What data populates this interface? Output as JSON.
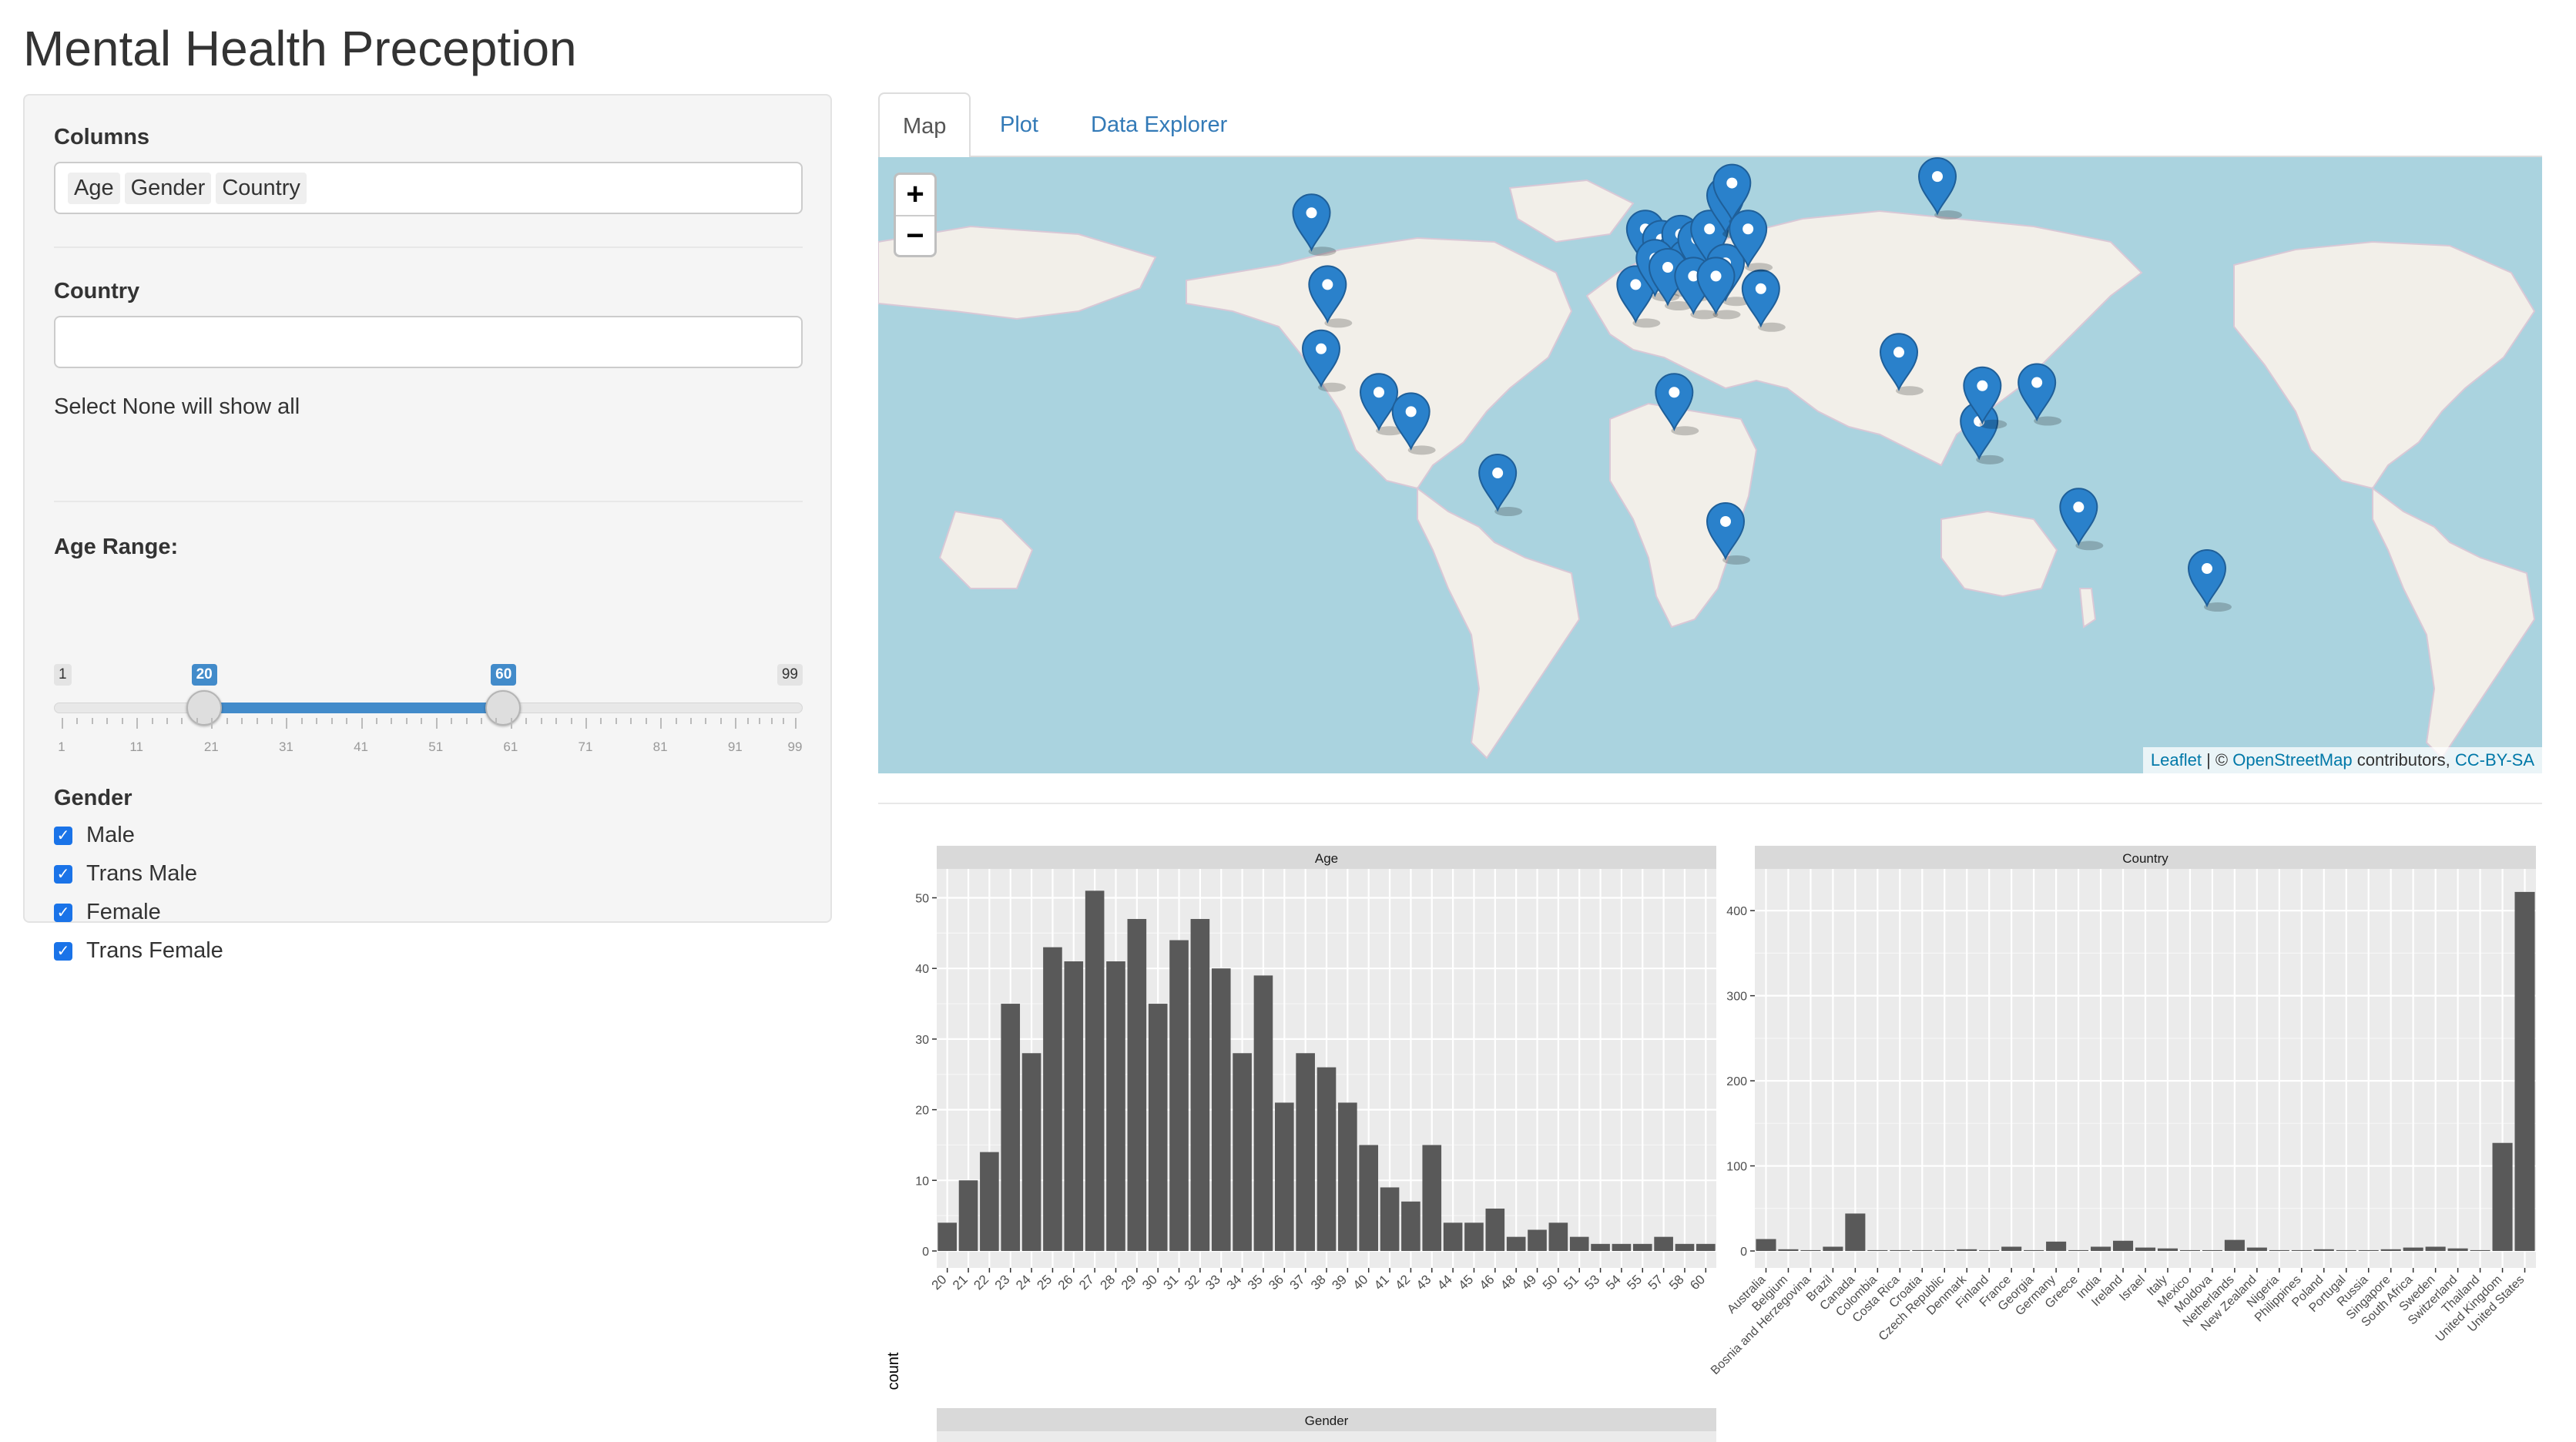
{
  "app_title": "Mental Health Preception",
  "sidebar": {
    "columns_label": "Columns",
    "columns_selected": [
      "Age",
      "Gender",
      "Country"
    ],
    "country_label": "Country",
    "country_value": "",
    "country_help": "Select None will show all",
    "age_label": "Age Range:",
    "age_slider": {
      "min": 1,
      "max": 99,
      "from": 20,
      "to": 60,
      "ticks": [
        "1",
        "11",
        "21",
        "31",
        "41",
        "51",
        "61",
        "71",
        "81",
        "91",
        "99"
      ],
      "min_label": "1",
      "max_label": "99",
      "from_label": "20",
      "to_label": "60"
    },
    "gender_label": "Gender",
    "gender_options": [
      {
        "label": "Male",
        "checked": true
      },
      {
        "label": "Trans Male",
        "checked": true
      },
      {
        "label": "Female",
        "checked": true
      },
      {
        "label": "Trans Female",
        "checked": true
      }
    ]
  },
  "tabs": [
    {
      "label": "Map",
      "active": true
    },
    {
      "label": "Plot",
      "active": false
    },
    {
      "label": "Data Explorer",
      "active": false
    }
  ],
  "map": {
    "zoom_in": "+",
    "zoom_out": "−",
    "attribution": {
      "leaflet": "Leaflet",
      "sep": "| ©",
      "osm": "OpenStreetMap",
      "contrib": "contributors,",
      "license": "CC-BY-SA"
    },
    "marker_icon": "map-marker-icon",
    "marker_color": "#2a81cb",
    "markers": [
      [
        -105,
        55
      ],
      [
        -100,
        40
      ],
      [
        -102,
        23
      ],
      [
        -84,
        10
      ],
      [
        -74,
        4
      ],
      [
        -47,
        -15
      ],
      [
        -1,
        52
      ],
      [
        4,
        50
      ],
      [
        8,
        47
      ],
      [
        10,
        51
      ],
      [
        12,
        46
      ],
      [
        15,
        50
      ],
      [
        19,
        52
      ],
      [
        24,
        58
      ],
      [
        26,
        60
      ],
      [
        24,
        45
      ],
      [
        -4,
        40
      ],
      [
        2,
        46
      ],
      [
        6,
        44
      ],
      [
        14,
        42
      ],
      [
        21,
        42
      ],
      [
        35,
        39
      ],
      [
        31,
        52
      ],
      [
        8,
        10
      ],
      [
        24,
        -29
      ],
      [
        78,
        22
      ],
      [
        103,
        1
      ],
      [
        104,
        12
      ],
      [
        121,
        13
      ],
      [
        90,
        61
      ],
      [
        134,
        -25
      ],
      [
        174,
        -41
      ]
    ]
  },
  "chart_data": [
    {
      "type": "bar",
      "title": "Age",
      "ylabel": "count",
      "categories": [
        "20",
        "21",
        "22",
        "23",
        "24",
        "25",
        "26",
        "27",
        "28",
        "29",
        "30",
        "31",
        "32",
        "33",
        "34",
        "35",
        "36",
        "37",
        "38",
        "39",
        "40",
        "41",
        "42",
        "43",
        "44",
        "45",
        "46",
        "48",
        "49",
        "50",
        "51",
        "53",
        "54",
        "55",
        "57",
        "58",
        "60"
      ],
      "values": [
        4,
        10,
        14,
        35,
        28,
        43,
        41,
        51,
        41,
        47,
        35,
        44,
        47,
        40,
        28,
        39,
        21,
        28,
        26,
        21,
        15,
        9,
        7,
        15,
        4,
        4,
        6,
        2,
        3,
        4,
        2,
        1,
        1,
        1,
        2,
        1,
        1
      ],
      "yticks": [
        0,
        10,
        20,
        30,
        40,
        50
      ],
      "ylim": [
        0,
        53
      ]
    },
    {
      "type": "bar",
      "title": "Country",
      "ylabel": "count",
      "categories": [
        "Australia",
        "Belgium",
        "Bosnia and Herzegovina",
        "Brazil",
        "Canada",
        "Colombia",
        "Costa Rica",
        "Croatia",
        "Czech Republic",
        "Denmark",
        "Finland",
        "France",
        "Georgia",
        "Germany",
        "Greece",
        "India",
        "Ireland",
        "Israel",
        "Italy",
        "Mexico",
        "Moldova",
        "Netherlands",
        "New Zealand",
        "Nigeria",
        "Philippines",
        "Poland",
        "Portugal",
        "Russia",
        "Singapore",
        "South Africa",
        "Sweden",
        "Switzerland",
        "Thailand",
        "United Kingdom",
        "United States"
      ],
      "values": [
        14,
        2,
        1,
        5,
        44,
        1,
        1,
        1,
        1,
        2,
        1,
        5,
        1,
        11,
        1,
        5,
        12,
        4,
        3,
        1,
        1,
        13,
        4,
        1,
        1,
        2,
        1,
        1,
        2,
        4,
        5,
        3,
        1,
        127,
        422
      ],
      "yticks": [
        0,
        100,
        200,
        300,
        400
      ],
      "ylim": [
        0,
        440
      ]
    },
    {
      "type": "bar",
      "title": "Gender"
    }
  ]
}
